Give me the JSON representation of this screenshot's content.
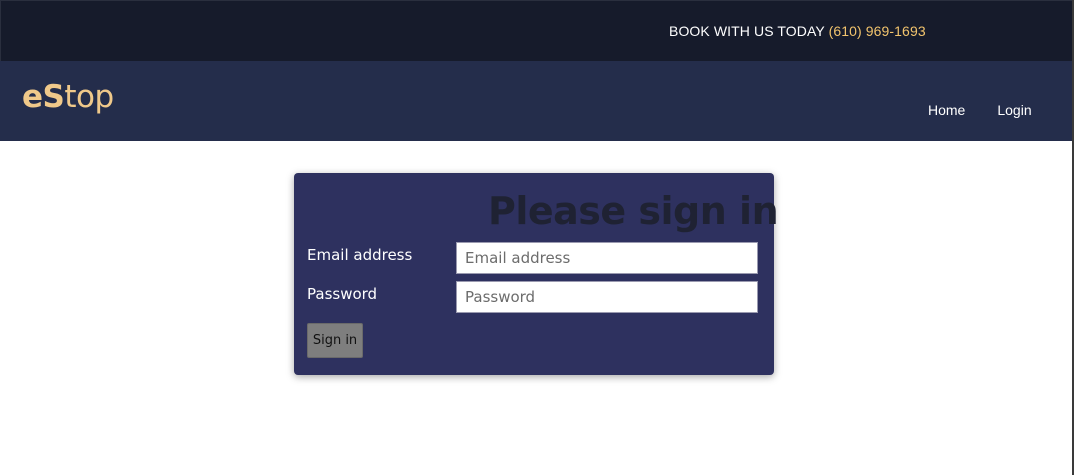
{
  "topbar": {
    "book_text": "BOOK WITH US TODAY",
    "phone": "(610) 969-1693"
  },
  "navbar": {
    "brand_strong": "eS",
    "brand_rest": "top",
    "links": [
      {
        "label": "Home"
      },
      {
        "label": "Login"
      }
    ]
  },
  "signin": {
    "title": "Please sign in",
    "email_label": "Email address",
    "email_placeholder": "Email address",
    "email_value": "",
    "password_label": "Password",
    "password_placeholder": "Password",
    "password_value": "",
    "button_label": "Sign in"
  },
  "colors": {
    "topbar_bg": "#161b2b",
    "navbar_bg": "#242d4b",
    "brand": "#f0c98a",
    "phone": "#f2c46d",
    "card_bg": "#2e315f",
    "button_bg": "#7e7e7e"
  }
}
